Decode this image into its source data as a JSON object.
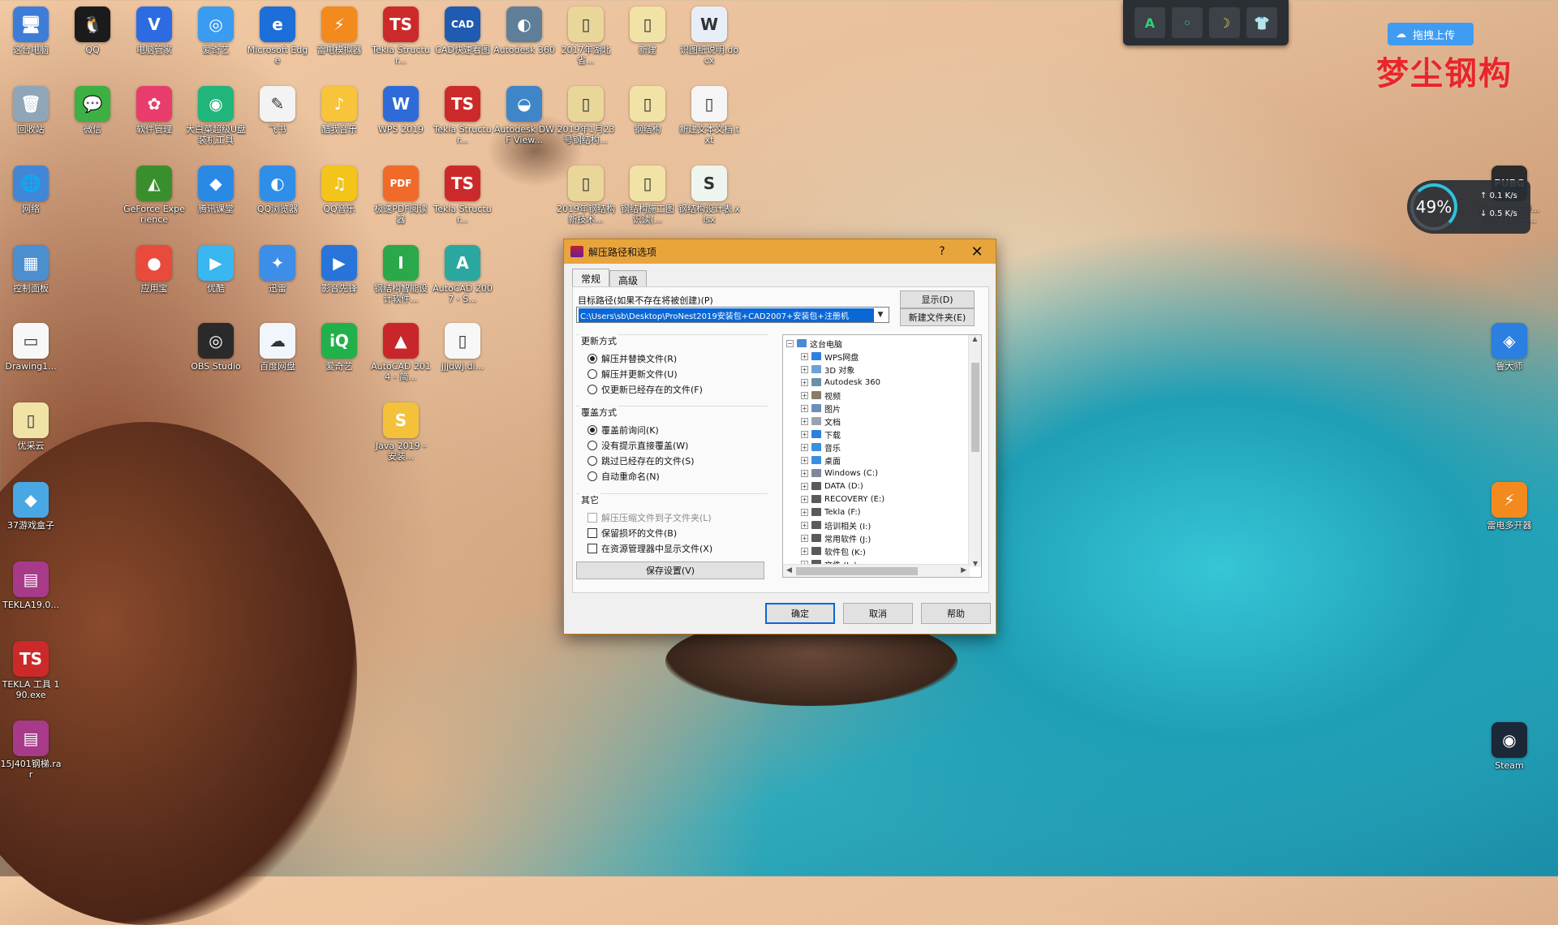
{
  "desktop": {
    "icons": [
      {
        "label": "这台电脑",
        "color": "#3d7dd8",
        "glyph": "🖥"
      },
      {
        "label": "QQ",
        "color": "#1b1b1b",
        "glyph": "🐧"
      },
      {
        "label": "电脑管家",
        "color": "#2d6be3",
        "glyph": "V"
      },
      {
        "label": "爱奇艺",
        "color": "#3a9cf0",
        "glyph": "◎"
      },
      {
        "label": "Microsoft Edge",
        "color": "#1c6ed8",
        "glyph": "e"
      },
      {
        "label": "雷电模拟器",
        "color": "#f28a1e",
        "glyph": "⚡"
      },
      {
        "label": "Tekla Structur...",
        "color": "#cc2a2a",
        "glyph": "TS"
      },
      {
        "label": "CAD快速看图",
        "color": "#1f5bb0",
        "glyph": "CAD"
      },
      {
        "label": "Autodesk 360",
        "color": "#5f7f98",
        "glyph": "◐"
      },
      {
        "label": "2017年湖北省...",
        "color": "#e9d79a",
        "glyph": "▯"
      },
      {
        "label": "新建",
        "color": "#f1e3a6",
        "glyph": "▯"
      },
      {
        "label": "识图纸说明.docx",
        "color": "#e8eef8",
        "glyph": "W"
      },
      {
        "label": "回收站",
        "color": "#8fa6b8",
        "glyph": "🗑"
      },
      {
        "label": "微信",
        "color": "#3cb043",
        "glyph": "💬"
      },
      {
        "label": "软件管理",
        "color": "#e83d6c",
        "glyph": "✿"
      },
      {
        "label": "大白菜超级U盘装机工具",
        "color": "#20b57a",
        "glyph": "◉"
      },
      {
        "label": "飞书",
        "color": "#f3f3f3",
        "glyph": "✎"
      },
      {
        "label": "酷我音乐",
        "color": "#f7c43b",
        "glyph": "♪"
      },
      {
        "label": "WPS 2019",
        "color": "#2f6bd8",
        "glyph": "W"
      },
      {
        "label": "Tekla Structur...",
        "color": "#cc2a2a",
        "glyph": "TS"
      },
      {
        "label": "Autodesk DWF View...",
        "color": "#3f86c8",
        "glyph": "◒"
      },
      {
        "label": "2019年1月23号钢结构...",
        "color": "#e9d79a",
        "glyph": "▯"
      },
      {
        "label": "钢结构",
        "color": "#f1e3a6",
        "glyph": "▯"
      },
      {
        "label": "新建文本文档.txt",
        "color": "#f5f5f5",
        "glyph": "▯"
      },
      {
        "label": "网络",
        "color": "#4287d6",
        "glyph": "🌐"
      },
      {
        "label": "GeForce Experience",
        "color": "#3a8f2d",
        "glyph": "◭"
      },
      {
        "label": "腾讯课堂",
        "color": "#2b89e6",
        "glyph": "◆"
      },
      {
        "label": "QQ浏览器",
        "color": "#2f8fe8",
        "glyph": "◐"
      },
      {
        "label": "QQ音乐",
        "color": "#f3c41a",
        "glyph": "♫"
      },
      {
        "label": "极速PDF阅读器",
        "color": "#f06a2a",
        "glyph": "PDF"
      },
      {
        "label": "Tekla Structur...",
        "color": "#cc2a2a",
        "glyph": "TS"
      },
      {
        "label": "2019年钢结构新技术...",
        "color": "#e9d79a",
        "glyph": "▯"
      },
      {
        "label": "钢结构施工图识读(...",
        "color": "#f1e3a6",
        "glyph": "▯"
      },
      {
        "label": "钢结构设计表.xlsx",
        "color": "#eef5ee",
        "glyph": "S"
      },
      {
        "label": "控制面板",
        "color": "#4c8fcf",
        "glyph": "▦"
      },
      {
        "label": "应用宝",
        "color": "#e84a3c",
        "glyph": "●"
      },
      {
        "label": "优酷",
        "color": "#3ab6f0",
        "glyph": "▶"
      },
      {
        "label": "迅雷",
        "color": "#3c8ee8",
        "glyph": "✦"
      },
      {
        "label": "影音先锋",
        "color": "#2874d8",
        "glyph": "▶"
      },
      {
        "label": "钢结构智能设计软件...",
        "color": "#2aa84a",
        "glyph": "I"
      },
      {
        "label": "AutoCAD 2007 - S...",
        "color": "#2aa8a0",
        "glyph": "A"
      },
      {
        "label": "Drawing1...",
        "color": "#f7f7f7",
        "glyph": "▭"
      },
      {
        "label": "OBS Studio",
        "color": "#2a2a2a",
        "glyph": "◎"
      },
      {
        "label": "百度网盘",
        "color": "#f0f6fc",
        "glyph": "☁"
      },
      {
        "label": "爱奇艺",
        "color": "#22b04a",
        "glyph": "iQ"
      },
      {
        "label": "AutoCAD 2014 - 简...",
        "color": "#c8262a",
        "glyph": "▲"
      },
      {
        "label": "jjjdwj.dl...",
        "color": "#f7f7f7",
        "glyph": "▯"
      },
      {
        "label": "优采云",
        "color": "#f1e3a6",
        "glyph": "▯"
      },
      {
        "label": "Java 2019 - 安装...",
        "color": "#f3c23a",
        "glyph": "S"
      },
      {
        "label": "37游戏盒子",
        "color": "#49a8e3",
        "glyph": "◆"
      },
      {
        "label": "TEKLA19.0...",
        "color": "#a83a8a",
        "glyph": "▤"
      },
      {
        "label": "TEKLA 工具 190.exe",
        "color": "#cc2a2a",
        "glyph": "TS"
      },
      {
        "label": "15J401钢梯.rar",
        "color": "#a83a8a",
        "glyph": "▤"
      },
      {
        "label": "PUBG BERU... BATTLEGR...",
        "color": "#2b2b2b",
        "glyph": "PUBG"
      },
      {
        "label": "鲁大师",
        "color": "#2a7fe0",
        "glyph": "◈"
      },
      {
        "label": "雷电多开器",
        "color": "#f28a1e",
        "glyph": "⚡"
      },
      {
        "label": "Steam",
        "color": "#1b2838",
        "glyph": "◉"
      }
    ]
  },
  "topbar": {
    "btn1": "A",
    "btn2": "◦",
    "btn3": "☽",
    "btn4": "👕"
  },
  "upload": {
    "label": "拖拽上传"
  },
  "watermark": {
    "text": "梦尘钢构"
  },
  "perf": {
    "percent": "49%",
    "up": "0.1",
    "down": "0.5"
  },
  "dialog": {
    "title": "解压路径和选项",
    "help_glyph": "?",
    "close_glyph": "✕",
    "tabs": [
      "常规",
      "高级"
    ],
    "path_label": "目标路径(如果不存在将被创建)(P)",
    "path_value": "C:\\Users\\sb\\Desktop\\ProNest2019安装包+CAD2007+安装包+注册机",
    "show_button": "显示(D)",
    "new_folder_button": "新建文件夹(E)",
    "update_mode": {
      "title": "更新方式",
      "options": [
        "解压并替换文件(R)",
        "解压并更新文件(U)",
        "仅更新已经存在的文件(F)"
      ],
      "selected": 0
    },
    "overwrite_mode": {
      "title": "覆盖方式",
      "options": [
        "覆盖前询问(K)",
        "没有提示直接覆盖(W)",
        "跳过已经存在的文件(S)",
        "自动重命名(N)"
      ],
      "selected": 0
    },
    "misc": {
      "title": "其它",
      "options": [
        "解压压缩文件到子文件夹(L)",
        "保留损坏的文件(B)",
        "在资源管理器中显示文件(X)"
      ],
      "disabled_index": 0
    },
    "save_settings": "保存设置(V)",
    "tree": [
      {
        "label": "这台电脑",
        "level": 0,
        "exp": "−",
        "color": "#4a89d6"
      },
      {
        "label": "WPS网盘",
        "level": 1,
        "exp": "+",
        "color": "#2f7fe0"
      },
      {
        "label": "3D 对象",
        "level": 1,
        "exp": "+",
        "color": "#6aa3d8"
      },
      {
        "label": "Autodesk 360",
        "level": 1,
        "exp": "+",
        "color": "#6a8fa8"
      },
      {
        "label": "视频",
        "level": 1,
        "exp": "+",
        "color": "#8a7c6a"
      },
      {
        "label": "图片",
        "level": 1,
        "exp": "+",
        "color": "#6a8fb8"
      },
      {
        "label": "文档",
        "level": 1,
        "exp": "+",
        "color": "#9aa3ad"
      },
      {
        "label": "下载",
        "level": 1,
        "exp": "+",
        "color": "#2a7fe0"
      },
      {
        "label": "音乐",
        "level": 1,
        "exp": "+",
        "color": "#3a8fe0"
      },
      {
        "label": "桌面",
        "level": 1,
        "exp": "+",
        "color": "#3a8fe0"
      },
      {
        "label": "Windows (C:)",
        "level": 1,
        "exp": "+",
        "color": "#7a8a9a"
      },
      {
        "label": "DATA (D:)",
        "level": 1,
        "exp": "+",
        "color": "#5a5a5a"
      },
      {
        "label": "RECOVERY (E:)",
        "level": 1,
        "exp": "+",
        "color": "#5a5a5a"
      },
      {
        "label": "Tekla (F:)",
        "level": 1,
        "exp": "+",
        "color": "#5a5a5a"
      },
      {
        "label": "培训相关 (I:)",
        "level": 1,
        "exp": "+",
        "color": "#5a5a5a"
      },
      {
        "label": "常用软件 (J:)",
        "level": 1,
        "exp": "+",
        "color": "#5a5a5a"
      },
      {
        "label": "软件包 (K:)",
        "level": 1,
        "exp": "+",
        "color": "#5a5a5a"
      },
      {
        "label": "文件 (L:)",
        "level": 1,
        "exp": "+",
        "color": "#5a5a5a"
      }
    ],
    "ok": "确定",
    "cancel": "取消",
    "help": "帮助"
  }
}
